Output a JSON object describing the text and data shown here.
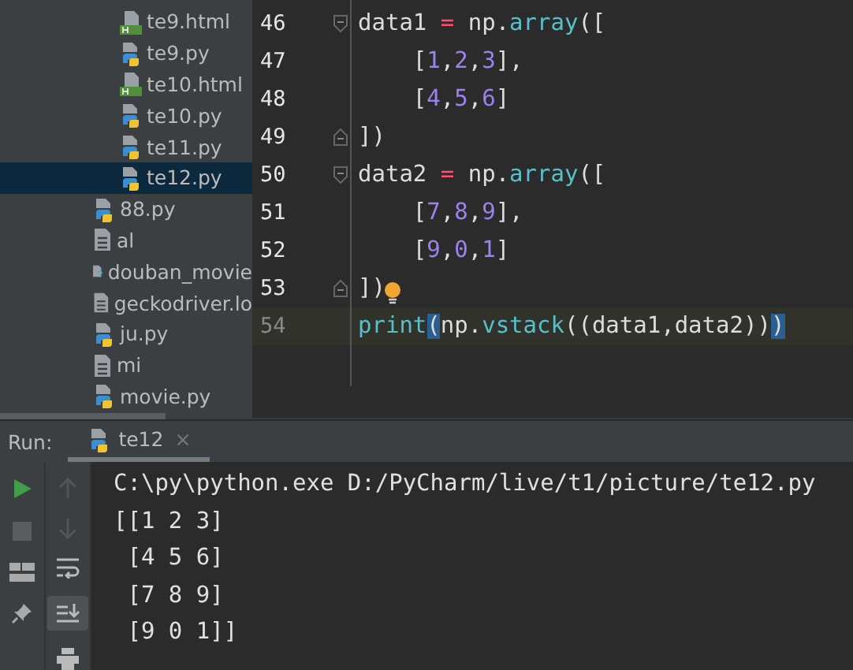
{
  "project_tree": [
    {
      "children": [
        {
          "label": "te9.html",
          "kind": "html",
          "selected": false
        },
        {
          "label": "te9.py",
          "kind": "python",
          "selected": false
        },
        {
          "label": "te10.html",
          "kind": "html",
          "selected": false
        },
        {
          "label": "te10.py",
          "kind": "python",
          "selected": false
        },
        {
          "label": "te11.py",
          "kind": "python",
          "selected": false
        },
        {
          "label": "te12.py",
          "kind": "python",
          "selected": true
        }
      ]
    },
    {
      "label": "88.py",
      "kind": "python",
      "selected": false
    },
    {
      "label": "al",
      "kind": "text",
      "selected": false
    },
    {
      "label": "douban_movie",
      "kind": "unknown",
      "selected": false
    },
    {
      "label": "geckodriver.lo",
      "kind": "text",
      "selected": false
    },
    {
      "label": "ju.py",
      "kind": "python",
      "selected": false
    },
    {
      "label": "mi",
      "kind": "text",
      "selected": false
    },
    {
      "label": "movie.py",
      "kind": "python",
      "selected": false
    }
  ],
  "editor": {
    "lines": [
      {
        "number": "46",
        "kind": "opener",
        "current": false,
        "tokens": [
          {
            "text": "data1 ",
            "kind": "plain"
          },
          {
            "text": "=",
            "kind": "op"
          },
          {
            "text": " np.",
            "kind": "plain"
          },
          {
            "text": "array",
            "kind": "func"
          },
          {
            "text": "([",
            "kind": "plain"
          }
        ]
      },
      {
        "number": "47",
        "kind": "plain",
        "current": false,
        "tokens": [
          {
            "text": "    [",
            "kind": "plain"
          },
          {
            "text": "1",
            "kind": "num"
          },
          {
            "text": ",",
            "kind": "plain"
          },
          {
            "text": "2",
            "kind": "num"
          },
          {
            "text": ",",
            "kind": "plain"
          },
          {
            "text": "3",
            "kind": "num"
          },
          {
            "text": "],",
            "kind": "plain"
          }
        ]
      },
      {
        "number": "48",
        "kind": "plain",
        "current": false,
        "tokens": [
          {
            "text": "    [",
            "kind": "plain"
          },
          {
            "text": "4",
            "kind": "num"
          },
          {
            "text": ",",
            "kind": "plain"
          },
          {
            "text": "5",
            "kind": "num"
          },
          {
            "text": ",",
            "kind": "plain"
          },
          {
            "text": "6",
            "kind": "num"
          },
          {
            "text": "]",
            "kind": "plain"
          }
        ]
      },
      {
        "number": "49",
        "kind": "closer",
        "current": false,
        "tokens": [
          {
            "text": "])",
            "kind": "plain"
          }
        ]
      },
      {
        "number": "50",
        "kind": "opener",
        "current": false,
        "tokens": [
          {
            "text": "data2 ",
            "kind": "plain"
          },
          {
            "text": "=",
            "kind": "op"
          },
          {
            "text": " np.",
            "kind": "plain"
          },
          {
            "text": "array",
            "kind": "func"
          },
          {
            "text": "([",
            "kind": "plain"
          }
        ]
      },
      {
        "number": "51",
        "kind": "plain",
        "current": false,
        "tokens": [
          {
            "text": "    [",
            "kind": "plain"
          },
          {
            "text": "7",
            "kind": "num"
          },
          {
            "text": ",",
            "kind": "plain"
          },
          {
            "text": "8",
            "kind": "num"
          },
          {
            "text": ",",
            "kind": "plain"
          },
          {
            "text": "9",
            "kind": "num"
          },
          {
            "text": "],",
            "kind": "plain"
          }
        ]
      },
      {
        "number": "52",
        "kind": "plain",
        "current": false,
        "tokens": [
          {
            "text": "    [",
            "kind": "plain"
          },
          {
            "text": "9",
            "kind": "num"
          },
          {
            "text": ",",
            "kind": "plain"
          },
          {
            "text": "0",
            "kind": "num"
          },
          {
            "text": ",",
            "kind": "plain"
          },
          {
            "text": "1",
            "kind": "num"
          },
          {
            "text": "]",
            "kind": "plain"
          }
        ]
      },
      {
        "number": "53",
        "kind": "closer",
        "current": false,
        "bulb": true,
        "tokens": [
          {
            "text": "]",
            "kind": "plain"
          },
          {
            "text": ")",
            "kind": "plain"
          }
        ]
      },
      {
        "number": "54",
        "kind": "plain",
        "current": true,
        "tokens": [
          {
            "text": "print",
            "kind": "func"
          },
          {
            "text": "(",
            "kind": "match"
          },
          {
            "text": "np.",
            "kind": "plain"
          },
          {
            "text": "vstack",
            "kind": "func"
          },
          {
            "text": "((data1,data2))",
            "kind": "plain"
          },
          {
            "text": ")",
            "kind": "match"
          }
        ]
      }
    ]
  },
  "run_panel": {
    "label": "Run:",
    "tabs": [
      {
        "label": "te12",
        "close": "×",
        "selected": true
      }
    ],
    "output": [
      "C:\\py\\python.exe D:/PyCharm/live/t1/picture/te12.py",
      "[[1 2 3]",
      " [4 5 6]",
      " [7 8 9]",
      " [9 0 1]]"
    ]
  }
}
